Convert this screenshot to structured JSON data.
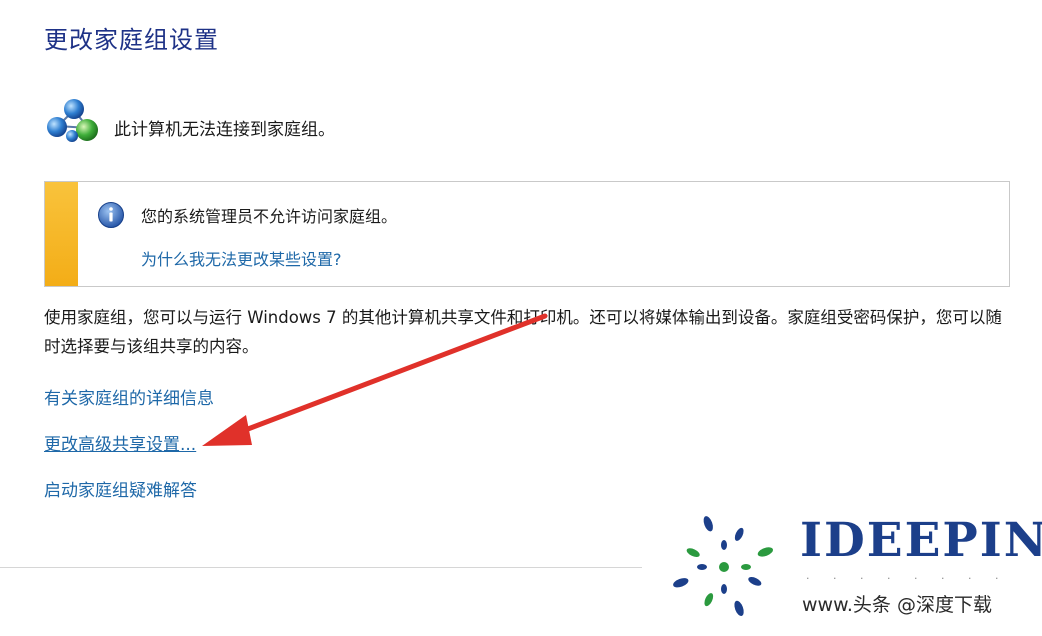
{
  "header": {
    "title": "更改家庭组设置"
  },
  "status": {
    "icon": "homegroup-network-icon",
    "text": "此计算机无法连接到家庭组。"
  },
  "info_box": {
    "accent_color": "#f3ad17",
    "icon": "info-icon",
    "message": "您的系统管理员不允许访问家庭组。",
    "link": "为什么我无法更改某些设置?"
  },
  "description": "使用家庭组，您可以与运行 Windows 7 的其他计算机共享文件和打印机。还可以将媒体输出到设备。家庭组受密码保护，您可以随时选择要与该组共享的内容。",
  "links": {
    "details": "有关家庭组的详细信息",
    "advanced_sharing": "更改高级共享设置...",
    "troubleshoot": "启动家庭组疑难解答"
  },
  "annotation": {
    "arrow_color": "#e0312a"
  },
  "watermark": {
    "logo_text": "IDEEPIN",
    "logo_dots": "· · · · · · · ·",
    "caption": "www.头条 @深度下载"
  }
}
